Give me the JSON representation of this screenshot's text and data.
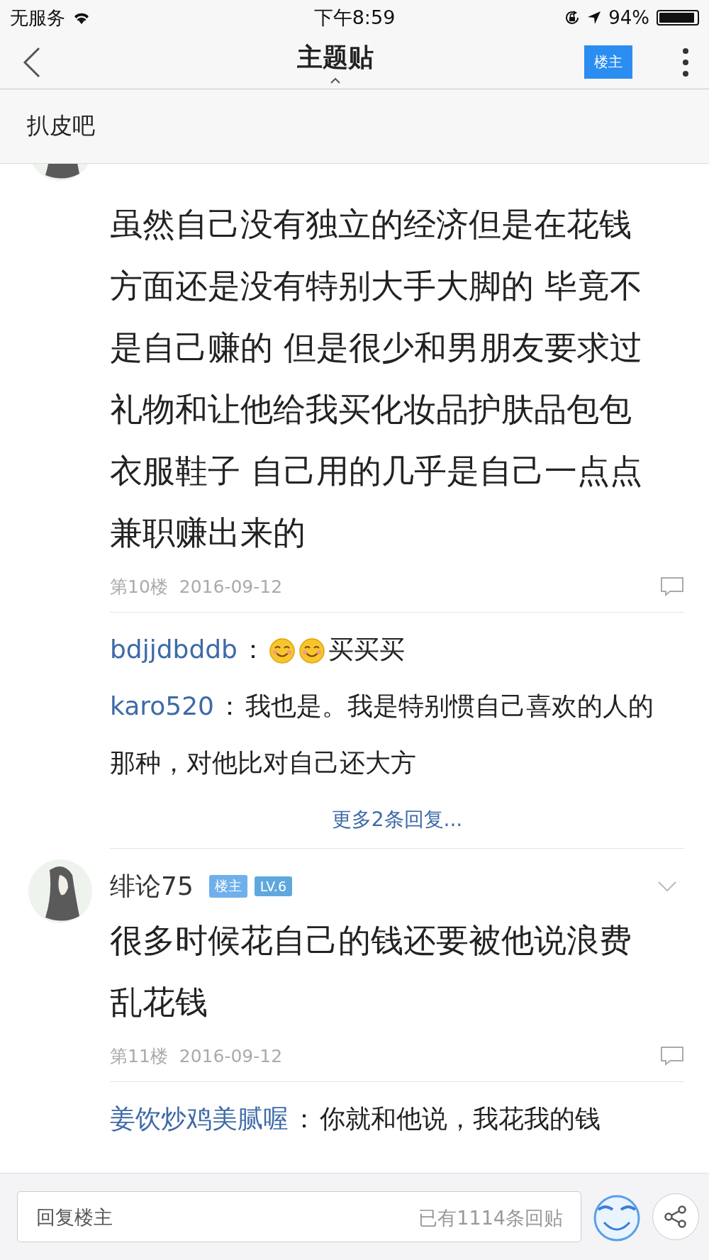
{
  "status_bar": {
    "carrier": "无服务",
    "time": "下午8:59",
    "battery_text": "94%",
    "battery": {
      "level": 0.94
    }
  },
  "nav": {
    "title": "主题贴",
    "owner_button": "楼主"
  },
  "forum": {
    "name": "扒皮吧"
  },
  "posts": [
    {
      "text": "虽然自己没有独立的经济但是在花钱方面还是没有特别大手大脚的 毕竟不是自己赚的 但是很少和男朋友要求过礼物和让他给我买化妆品护肤品包包衣服鞋子 自己用的几乎是自己一点点兼职赚出来的",
      "floor": "第10楼",
      "date": "2016-09-12",
      "replies": [
        {
          "user": "bdjjdbddb",
          "separator": "：",
          "parts": [
            {
              "kind": "emoticon"
            },
            {
              "kind": "emoticon"
            },
            {
              "kind": "text",
              "text": "买买买"
            }
          ]
        },
        {
          "user": "karo520",
          "separator": "：",
          "parts": [
            {
              "kind": "text",
              "text": "我也是。我是特别惯自己喜欢的人的那种，对他比对自己还大方"
            }
          ]
        }
      ],
      "more_replies": "更多2条回复..."
    },
    {
      "user": "绯论75",
      "badges": [
        "楼主",
        "LV.6"
      ],
      "text": "很多时候花自己的钱还要被他说浪费乱花钱",
      "floor": "第11楼",
      "date": "2016-09-12",
      "replies": [
        {
          "user": "姜饮炒鸡美腻喔",
          "separator": "：",
          "parts": [
            {
              "kind": "text",
              "text": "你就和他说，我花我的钱"
            }
          ]
        }
      ]
    }
  ],
  "bottom_bar": {
    "reply_field": {
      "placeholder": "回复楼主"
    },
    "reply_count": "已有1114条回贴"
  }
}
